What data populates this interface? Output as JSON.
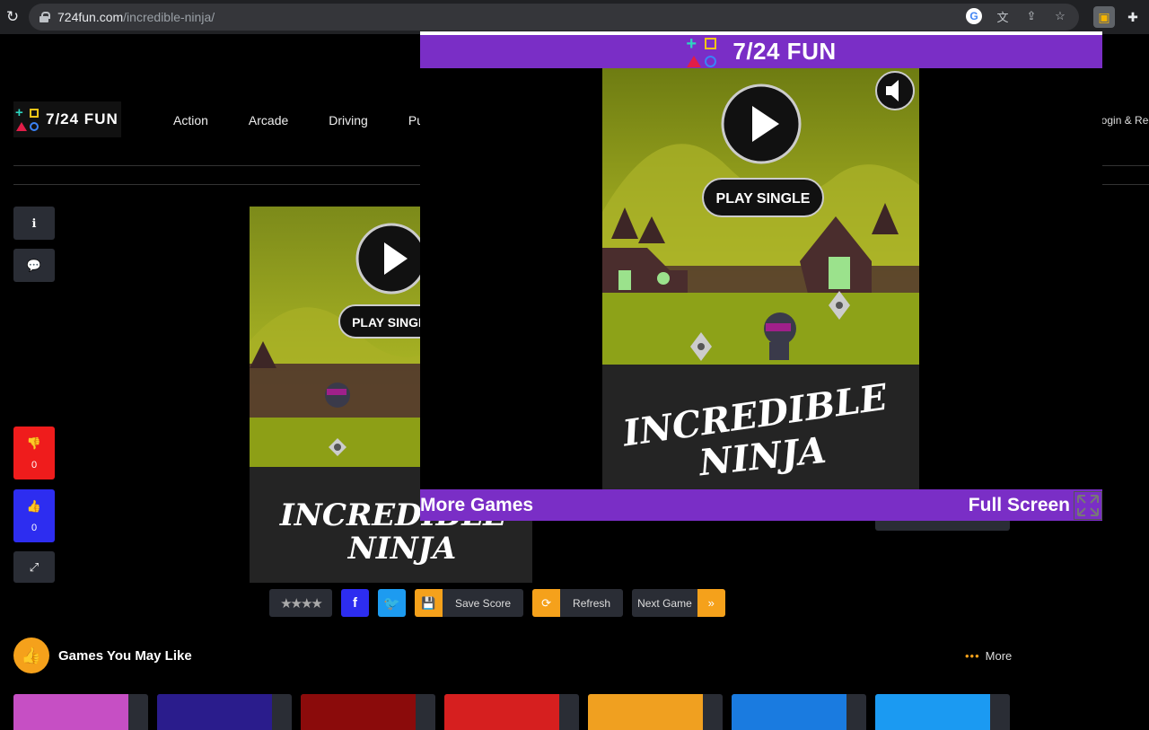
{
  "browser": {
    "url_host": "724fun.com",
    "url_path": "/incredible-ninja/"
  },
  "site": {
    "logo_text": "7/24 FUN",
    "nav": [
      "Action",
      "Arcade",
      "Driving",
      "Pu"
    ],
    "login": "Login & Reg"
  },
  "sidebar": {
    "dislike_count": "0",
    "like_count": "0"
  },
  "game": {
    "play_label": "PLAY SINGLE",
    "title_line1": "INCREDIBLE",
    "title_line2": "NINJA"
  },
  "actions": {
    "stars": "★★★★",
    "facebook": "f",
    "save_score": "Save Score",
    "refresh": "Refresh",
    "next_game": "Next Game"
  },
  "recommend": {
    "title": "Games You May Like",
    "more": "More",
    "thumb_colors": [
      "#c64fc4",
      "#2a1c8c",
      "#8b0b0b",
      "#d61f1f",
      "#f0a020",
      "#1a7be0",
      "#1b9af2"
    ]
  },
  "popup": {
    "logo_text": "7/24 FUN",
    "more_games": "More Games",
    "full_screen": "Full Screen"
  },
  "colors": {
    "accent_purple": "#7a2ec6",
    "accent_orange": "#f5a11b",
    "like_blue": "#2d2df0",
    "dislike_red": "#ef1c1c"
  }
}
